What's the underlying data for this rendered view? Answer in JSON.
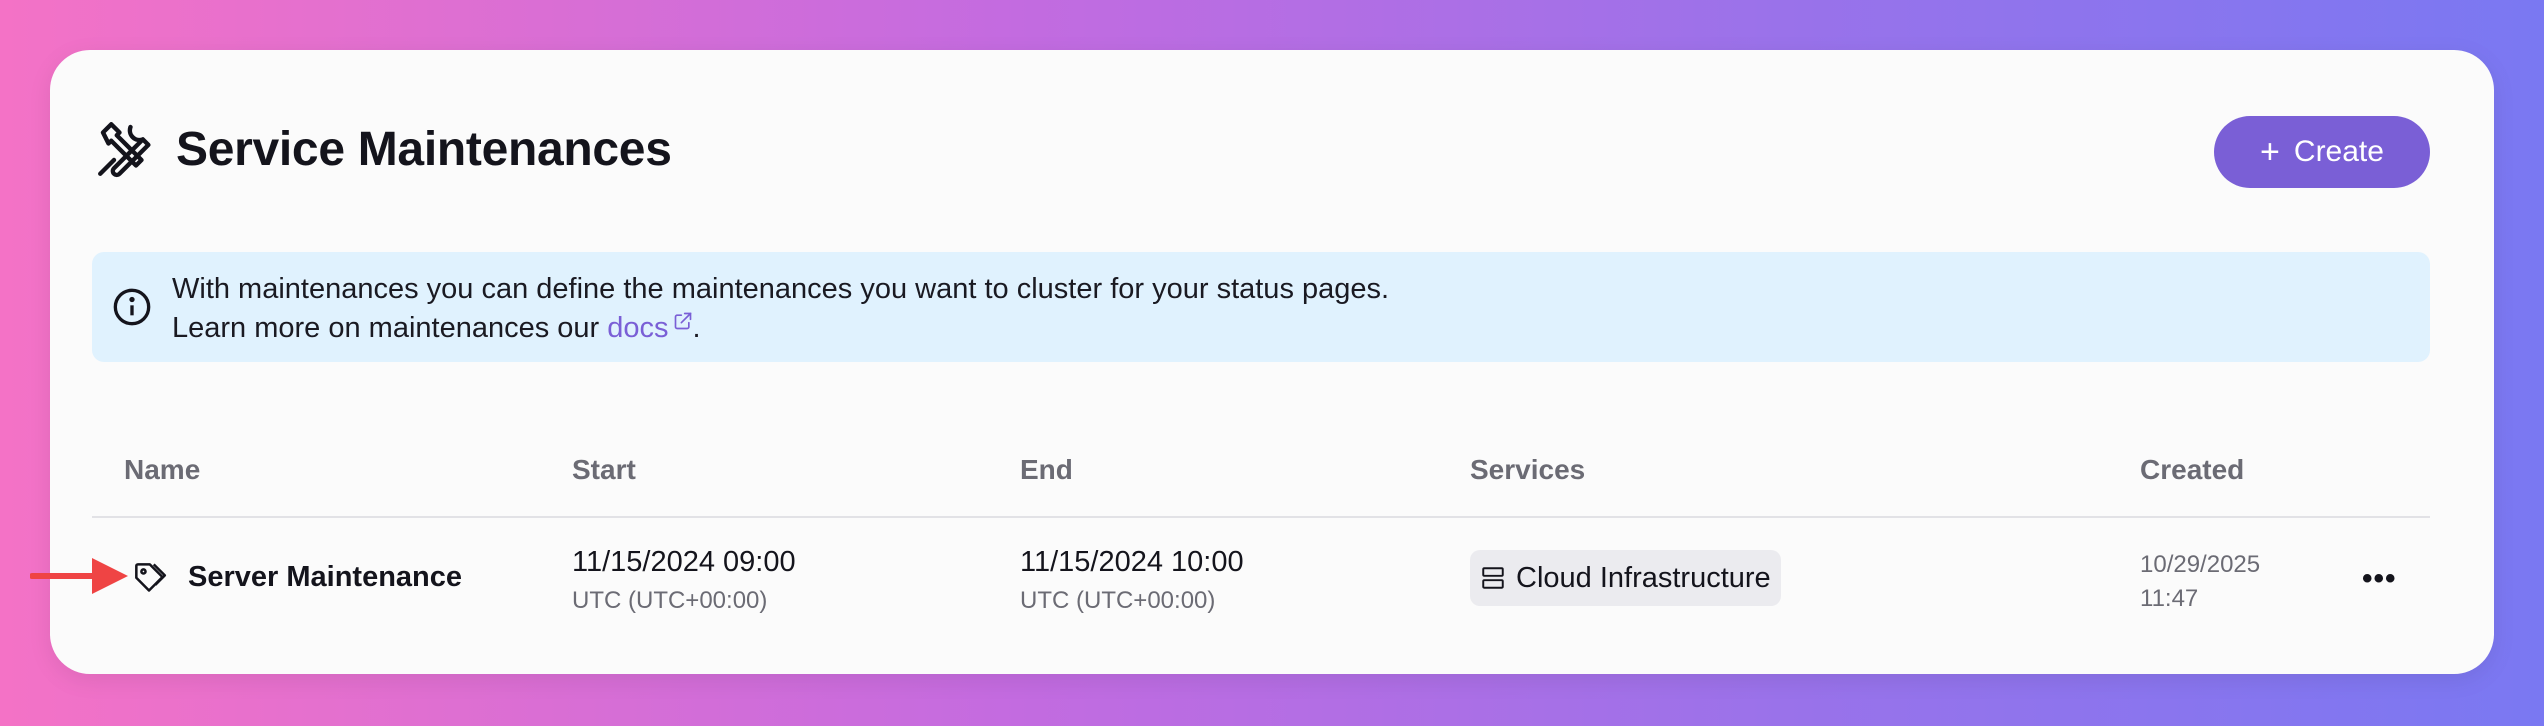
{
  "page": {
    "title": "Service Maintenances",
    "create_label": "Create"
  },
  "info": {
    "line1": "With maintenances you can define the maintenances you want to cluster for your status pages.",
    "line2_prefix": "Learn more on maintenances our ",
    "link_label": "docs",
    "line2_suffix": "."
  },
  "table": {
    "headers": {
      "name": "Name",
      "start": "Start",
      "end": "End",
      "services": "Services",
      "created": "Created"
    },
    "rows": [
      {
        "name": "Server Maintenance",
        "start_date": "11/15/2024 09:00",
        "start_tz": "UTC (UTC+00:00)",
        "end_date": "11/15/2024 10:00",
        "end_tz": "UTC (UTC+00:00)",
        "service": "Cloud Infrastructure",
        "created_date": "10/29/2025",
        "created_time": "11:47",
        "more_label": "•••"
      }
    ]
  },
  "colors": {
    "accent": "#7a5fd6",
    "info_bg": "#e0f2fe",
    "annotation_arrow": "#ef4444"
  },
  "icons": {
    "title": "hammer-wrench-icon",
    "create": "plus-icon",
    "info": "info-icon",
    "link": "external-link-icon",
    "row": "tag-icon",
    "service": "server-icon",
    "more": "more-horizontal-icon"
  }
}
